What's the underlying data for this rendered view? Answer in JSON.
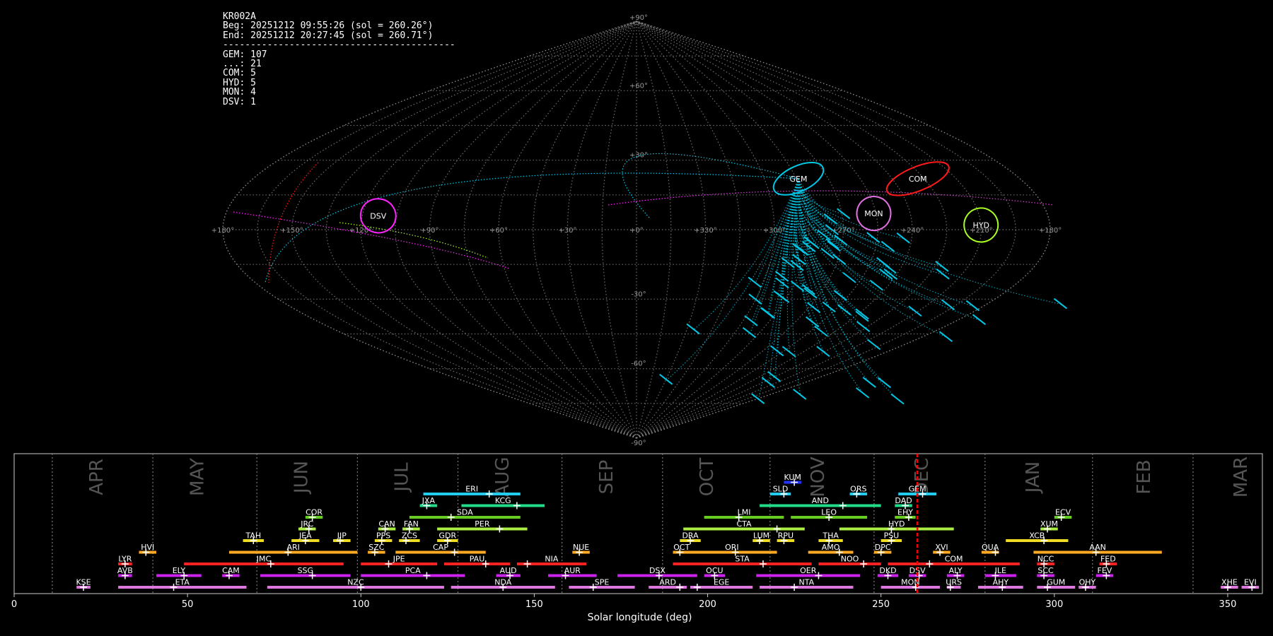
{
  "info": {
    "station": "KR002A",
    "begin": "Beg: 20251212 09:55:26 (sol = 260.26°)",
    "end": "End: 20251212 20:27:45 (sol = 260.71°)",
    "separator": "------------------------------------------",
    "counts": [
      "GEM: 107",
      "...: 21",
      "COM: 5",
      "HYD: 5",
      "MON: 4",
      "DSV: 1"
    ]
  },
  "colors": {
    "background": "#000000",
    "grid": "#888888",
    "GEM": "#00c8e6",
    "COM": "#ff1a1a",
    "HYD": "#aaff22",
    "MON": "#e070e0",
    "DSV": "#ff22ff",
    "sporadic": "#ff22ff",
    "now_marker": "#ff0000"
  },
  "sky": {
    "lon_labels": [
      "+180°",
      "+150°",
      "+120°",
      "+90°",
      "+60°",
      "+30°",
      "+0°",
      "+330°",
      "+300°",
      "+270°",
      "+240°",
      "+210°",
      "+180°"
    ],
    "lat_labels": [
      "+90°",
      "+60°",
      "+30°",
      "-30°",
      "-60°",
      "-90°"
    ],
    "radiant_labels": [
      {
        "code": "COM",
        "lon": 132,
        "lat": 22
      },
      {
        "code": "GEM",
        "lon": 76,
        "lat": 22
      },
      {
        "code": "MON",
        "lon": 104,
        "lat": 7
      },
      {
        "code": "HYD",
        "lon": 150,
        "lat": 2
      },
      {
        "code": "DSV",
        "lon": 247,
        "lat": 6
      }
    ]
  },
  "chart_data": {
    "type": "timeline",
    "xlabel": "Solar longitude (deg)",
    "xlim": [
      0,
      360
    ],
    "xticks": [
      0,
      50,
      100,
      150,
      200,
      250,
      300,
      350
    ],
    "current_sol": 260.5,
    "months": [
      {
        "name": "APR",
        "pos": 24,
        "boundary": 11
      },
      {
        "name": "MAY",
        "pos": 53,
        "boundary": 40
      },
      {
        "name": "JUN",
        "pos": 83,
        "boundary": 70
      },
      {
        "name": "JUL",
        "pos": 112,
        "boundary": 99
      },
      {
        "name": "AUG",
        "pos": 141,
        "boundary": 128
      },
      {
        "name": "SEP",
        "pos": 171,
        "boundary": 158
      },
      {
        "name": "OCT",
        "pos": 200,
        "boundary": 187
      },
      {
        "name": "NOV",
        "pos": 232,
        "boundary": 218
      },
      {
        "name": "DEC",
        "pos": 262,
        "boundary": 248
      },
      {
        "name": "JAN",
        "pos": 294,
        "boundary": 280
      },
      {
        "name": "FEB",
        "pos": 326,
        "boundary": 311
      },
      {
        "name": "MAR",
        "pos": 354,
        "boundary": 340
      }
    ],
    "showers": [
      {
        "code": "KUM",
        "start": 222,
        "end": 227,
        "peak": 225,
        "row": 10,
        "color": "#2233ff"
      },
      {
        "code": "ERI",
        "start": 118,
        "end": 146,
        "peak": 137,
        "row": 9,
        "color": "#22ccee"
      },
      {
        "code": "SLD",
        "start": 218,
        "end": 224,
        "peak": 222,
        "row": 9,
        "color": "#22ccee"
      },
      {
        "code": "ORS",
        "start": 241,
        "end": 246,
        "peak": 243,
        "row": 9,
        "color": "#22ccee"
      },
      {
        "code": "GEM",
        "start": 255,
        "end": 266,
        "peak": 262,
        "row": 9,
        "color": "#22ccee"
      },
      {
        "code": "JXA",
        "start": 117,
        "end": 122,
        "peak": 119,
        "row": 8,
        "color": "#22dd88"
      },
      {
        "code": "KCG",
        "start": 129,
        "end": 153,
        "peak": 145,
        "row": 8,
        "color": "#22dd88"
      },
      {
        "code": "AND",
        "start": 215,
        "end": 250,
        "peak": 239,
        "row": 8,
        "color": "#22dd88"
      },
      {
        "code": "DAD",
        "start": 254,
        "end": 259,
        "peak": 257,
        "row": 8,
        "color": "#22dd88"
      },
      {
        "code": "COR",
        "start": 84,
        "end": 89,
        "peak": 86,
        "row": 7,
        "color": "#66cc22"
      },
      {
        "code": "SDA",
        "start": 114,
        "end": 146,
        "peak": 126,
        "row": 7,
        "color": "#66cc22"
      },
      {
        "code": "LMI",
        "start": 199,
        "end": 222,
        "peak": 209,
        "row": 7,
        "color": "#66cc22"
      },
      {
        "code": "LEO",
        "start": 224,
        "end": 246,
        "peak": 235,
        "row": 7,
        "color": "#66cc22"
      },
      {
        "code": "EHY",
        "start": 254,
        "end": 260,
        "peak": 258,
        "row": 7,
        "color": "#66cc22"
      },
      {
        "code": "ECV",
        "start": 300,
        "end": 305,
        "peak": 302,
        "row": 7,
        "color": "#66cc22"
      },
      {
        "code": "JRC",
        "start": 82,
        "end": 87,
        "peak": 85,
        "row": 6,
        "color": "#aaee44"
      },
      {
        "code": "CAN",
        "start": 105,
        "end": 110,
        "peak": 107,
        "row": 6,
        "color": "#aaee44"
      },
      {
        "code": "FAN",
        "start": 112,
        "end": 117,
        "peak": 114,
        "row": 6,
        "color": "#aaee44"
      },
      {
        "code": "PER",
        "start": 122,
        "end": 148,
        "peak": 140,
        "row": 6,
        "color": "#aaee44"
      },
      {
        "code": "CTA",
        "start": 193,
        "end": 228,
        "peak": 220,
        "row": 6,
        "color": "#aaee44"
      },
      {
        "code": "HYD",
        "start": 238,
        "end": 271,
        "peak": 253,
        "row": 6,
        "color": "#aaee44"
      },
      {
        "code": "XUM",
        "start": 296,
        "end": 301,
        "peak": 298,
        "row": 6,
        "color": "#aaee44"
      },
      {
        "code": "TAH",
        "start": 66,
        "end": 72,
        "peak": 69,
        "row": 5,
        "color": "#eedd22"
      },
      {
        "code": "JEA",
        "start": 80,
        "end": 88,
        "peak": 84,
        "row": 5,
        "color": "#eedd22"
      },
      {
        "code": "JIP",
        "start": 92,
        "end": 97,
        "peak": 94,
        "row": 5,
        "color": "#eedd22"
      },
      {
        "code": "PPS",
        "start": 104,
        "end": 109,
        "peak": 106,
        "row": 5,
        "color": "#eedd22"
      },
      {
        "code": "ZCS",
        "start": 111,
        "end": 117,
        "peak": 113,
        "row": 5,
        "color": "#eedd22"
      },
      {
        "code": "GDR",
        "start": 122,
        "end": 128,
        "peak": 125,
        "row": 5,
        "color": "#eedd22"
      },
      {
        "code": "DRA",
        "start": 192,
        "end": 198,
        "peak": 195,
        "row": 5,
        "color": "#eedd22"
      },
      {
        "code": "LUM",
        "start": 213,
        "end": 218,
        "peak": 215,
        "row": 5,
        "color": "#eedd22"
      },
      {
        "code": "RPU",
        "start": 220,
        "end": 225,
        "peak": 222,
        "row": 5,
        "color": "#eedd22"
      },
      {
        "code": "THA",
        "start": 232,
        "end": 239,
        "peak": 235,
        "row": 5,
        "color": "#eedd22"
      },
      {
        "code": "PSU",
        "start": 250,
        "end": 256,
        "peak": 253,
        "row": 5,
        "color": "#eedd22"
      },
      {
        "code": "XCB",
        "start": 286,
        "end": 304,
        "peak": 297,
        "row": 5,
        "color": "#eedd22"
      },
      {
        "code": "HVI",
        "start": 36,
        "end": 41,
        "peak": 38,
        "row": 4,
        "color": "#ffaa22"
      },
      {
        "code": "ARI",
        "start": 62,
        "end": 99,
        "peak": 79,
        "row": 4,
        "color": "#ffaa22"
      },
      {
        "code": "SZC",
        "start": 102,
        "end": 107,
        "peak": 104,
        "row": 4,
        "color": "#ffaa22"
      },
      {
        "code": "CAP",
        "start": 110,
        "end": 136,
        "peak": 127,
        "row": 4,
        "color": "#ffaa22"
      },
      {
        "code": "NUE",
        "start": 161,
        "end": 166,
        "peak": 163,
        "row": 4,
        "color": "#ffaa22"
      },
      {
        "code": "OCT",
        "start": 190,
        "end": 195,
        "peak": 192,
        "row": 4,
        "color": "#ffaa22"
      },
      {
        "code": "ORI",
        "start": 194,
        "end": 220,
        "peak": 208,
        "row": 4,
        "color": "#ffaa22"
      },
      {
        "code": "AMO",
        "start": 229,
        "end": 242,
        "peak": 238,
        "row": 4,
        "color": "#ffaa22"
      },
      {
        "code": "DPC",
        "start": 248,
        "end": 253,
        "peak": 250,
        "row": 4,
        "color": "#ffaa22"
      },
      {
        "code": "XVI",
        "start": 265,
        "end": 270,
        "peak": 267,
        "row": 4,
        "color": "#ffaa22"
      },
      {
        "code": "QUA",
        "start": 279,
        "end": 284,
        "peak": 283,
        "row": 4,
        "color": "#ffaa22"
      },
      {
        "code": "AAN",
        "start": 294,
        "end": 331,
        "peak": 312,
        "row": 4,
        "color": "#ffaa22"
      },
      {
        "code": "LYR",
        "start": 30,
        "end": 34,
        "peak": 32,
        "row": 3,
        "color": "#ff2222"
      },
      {
        "code": "JMC",
        "start": 49,
        "end": 95,
        "peak": 74,
        "row": 3,
        "color": "#ff2222"
      },
      {
        "code": "JPE",
        "start": 100,
        "end": 122,
        "peak": 108,
        "row": 3,
        "color": "#ff2222"
      },
      {
        "code": "PAU",
        "start": 124,
        "end": 143,
        "peak": 136,
        "row": 3,
        "color": "#ff2222"
      },
      {
        "code": "NIA",
        "start": 145,
        "end": 165,
        "peak": 148,
        "row": 3,
        "color": "#ff2222"
      },
      {
        "code": "STA",
        "start": 190,
        "end": 230,
        "peak": 216,
        "row": 3,
        "color": "#ff2222"
      },
      {
        "code": "NOO",
        "start": 232,
        "end": 250,
        "peak": 245,
        "row": 3,
        "color": "#ff2222"
      },
      {
        "code": "COM",
        "start": 252,
        "end": 290,
        "peak": 264,
        "row": 3,
        "color": "#ff2222"
      },
      {
        "code": "NCC",
        "start": 295,
        "end": 300,
        "peak": 297,
        "row": 3,
        "color": "#ff2222"
      },
      {
        "code": "FED",
        "start": 313,
        "end": 318,
        "peak": 315,
        "row": 3,
        "color": "#ff2222"
      },
      {
        "code": "AVB",
        "start": 30,
        "end": 34,
        "peak": 32,
        "row": 2,
        "color": "#cc22ee"
      },
      {
        "code": "ELY",
        "start": 41,
        "end": 54,
        "peak": 49,
        "row": 2,
        "color": "#cc22ee"
      },
      {
        "code": "CAM",
        "start": 60,
        "end": 65,
        "peak": 62,
        "row": 2,
        "color": "#cc22ee"
      },
      {
        "code": "SSG",
        "start": 71,
        "end": 97,
        "peak": 86,
        "row": 2,
        "color": "#cc22ee"
      },
      {
        "code": "PCA",
        "start": 100,
        "end": 130,
        "peak": 119,
        "row": 2,
        "color": "#cc22ee"
      },
      {
        "code": "AUD",
        "start": 139,
        "end": 146,
        "peak": 143,
        "row": 2,
        "color": "#cc22ee"
      },
      {
        "code": "AUR",
        "start": 154,
        "end": 168,
        "peak": 159,
        "row": 2,
        "color": "#cc22ee"
      },
      {
        "code": "DSX",
        "start": 174,
        "end": 197,
        "peak": 186,
        "row": 2,
        "color": "#cc22ee"
      },
      {
        "code": "OCU",
        "start": 199,
        "end": 205,
        "peak": 202,
        "row": 2,
        "color": "#cc22ee"
      },
      {
        "code": "OER",
        "start": 214,
        "end": 244,
        "peak": 232,
        "row": 2,
        "color": "#cc22ee"
      },
      {
        "code": "DKD",
        "start": 249,
        "end": 255,
        "peak": 252,
        "row": 2,
        "color": "#cc22ee"
      },
      {
        "code": "DSV",
        "start": 258,
        "end": 263,
        "peak": 261,
        "row": 2,
        "color": "#cc22ee"
      },
      {
        "code": "ALY",
        "start": 269,
        "end": 274,
        "peak": 272,
        "row": 2,
        "color": "#cc22ee"
      },
      {
        "code": "ILE",
        "start": 280,
        "end": 289,
        "peak": 283,
        "row": 2,
        "color": "#cc22ee"
      },
      {
        "code": "SCC",
        "start": 295,
        "end": 300,
        "peak": 297,
        "row": 2,
        "color": "#cc22ee"
      },
      {
        "code": "FEV",
        "start": 312,
        "end": 317,
        "peak": 315,
        "row": 2,
        "color": "#cc22ee"
      },
      {
        "code": "KSE",
        "start": 18,
        "end": 22,
        "peak": 20,
        "row": 1,
        "color": "#dd77dd"
      },
      {
        "code": "ETA",
        "start": 30,
        "end": 67,
        "peak": 46,
        "row": 1,
        "color": "#dd77dd"
      },
      {
        "code": "NZC",
        "start": 73,
        "end": 124,
        "peak": 100,
        "row": 1,
        "color": "#dd77dd"
      },
      {
        "code": "NDA",
        "start": 126,
        "end": 156,
        "peak": 141,
        "row": 1,
        "color": "#dd77dd"
      },
      {
        "code": "SPE",
        "start": 160,
        "end": 179,
        "peak": 167,
        "row": 1,
        "color": "#dd77dd"
      },
      {
        "code": "ARD",
        "start": 183,
        "end": 194,
        "peak": 192,
        "row": 1,
        "color": "#dd77dd"
      },
      {
        "code": "EGE",
        "start": 195,
        "end": 213,
        "peak": 197,
        "row": 1,
        "color": "#dd77dd"
      },
      {
        "code": "NTA",
        "start": 215,
        "end": 242,
        "peak": 225,
        "row": 1,
        "color": "#dd77dd"
      },
      {
        "code": "MON",
        "start": 250,
        "end": 267,
        "peak": 260,
        "row": 1,
        "color": "#dd77dd"
      },
      {
        "code": "URS",
        "start": 269,
        "end": 273,
        "peak": 270,
        "row": 1,
        "color": "#dd77dd"
      },
      {
        "code": "AHY",
        "start": 278,
        "end": 291,
        "peak": 285,
        "row": 1,
        "color": "#dd77dd"
      },
      {
        "code": "GUM",
        "start": 295,
        "end": 306,
        "peak": 298,
        "row": 1,
        "color": "#dd77dd"
      },
      {
        "code": "OHY",
        "start": 307,
        "end": 312,
        "peak": 309,
        "row": 1,
        "color": "#dd77dd"
      },
      {
        "code": "XHE",
        "start": 348,
        "end": 353,
        "peak": 350,
        "row": 1,
        "color": "#dd77dd"
      },
      {
        "code": "EVI",
        "start": 354,
        "end": 359,
        "peak": 357,
        "row": 1,
        "color": "#dd77dd"
      }
    ]
  }
}
